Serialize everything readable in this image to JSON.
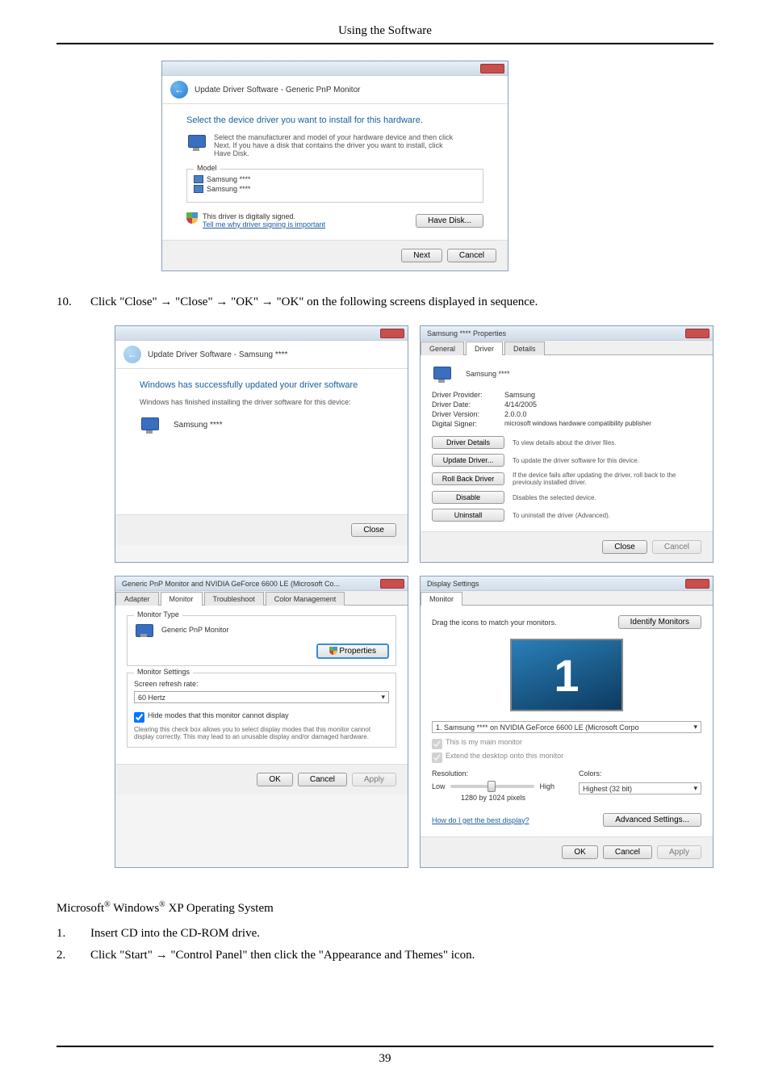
{
  "page_header": "Using the Software",
  "page_number": "39",
  "fig1": {
    "nav_title": "Update Driver Software - Generic PnP Monitor",
    "heading": "Select the device driver you want to install for this hardware.",
    "subtext": "Select the manufacturer and model of your hardware device and then click Next. If you have a disk that contains the driver you want to install, click Have Disk.",
    "model_legend": "Model",
    "model_items": [
      "Samsung ****",
      "Samsung ****"
    ],
    "signed_text": "This driver is digitally signed.",
    "signed_link": "Tell me why driver signing is important",
    "have_disk_btn": "Have Disk...",
    "next_btn": "Next",
    "cancel_btn": "Cancel"
  },
  "step10": {
    "num": "10.",
    "text": "Click \"Close\" → \"Close\" → \"OK\" → \"OK\" on the following screens displayed in sequence."
  },
  "quad_tl": {
    "nav_title": "Update Driver Software - Samsung ****",
    "heading": "Windows has successfully updated your driver software",
    "subtext": "Windows has finished installing the driver software for this device:",
    "device": "Samsung ****",
    "close_btn": "Close"
  },
  "quad_tr": {
    "title": "Samsung **** Properties",
    "tabs": [
      "General",
      "Driver",
      "Details"
    ],
    "device_name": "Samsung ****",
    "rows": {
      "provider_lbl": "Driver Provider:",
      "provider_val": "Samsung",
      "date_lbl": "Driver Date:",
      "date_val": "4/14/2005",
      "version_lbl": "Driver Version:",
      "version_val": "2.0.0.0",
      "signer_lbl": "Digital Signer:",
      "signer_val": "microsoft windows hardware compatibility publisher"
    },
    "btns": {
      "details": "Driver Details",
      "details_desc": "To view details about the driver files.",
      "update": "Update Driver...",
      "update_desc": "To update the driver software for this device.",
      "rollback": "Roll Back Driver",
      "rollback_desc": "If the device fails after updating the driver, roll back to the previously installed driver.",
      "disable": "Disable",
      "disable_desc": "Disables the selected device.",
      "uninstall": "Uninstall",
      "uninstall_desc": "To uninstall the driver (Advanced)."
    },
    "close_btn": "Close",
    "cancel_btn": "Cancel"
  },
  "quad_bl": {
    "title": "Generic PnP Monitor and NVIDIA GeForce 6600 LE (Microsoft Co...",
    "tabs": [
      "Adapter",
      "Monitor",
      "Troubleshoot",
      "Color Management"
    ],
    "monitor_type_legend": "Monitor Type",
    "monitor_name": "Generic PnP Monitor",
    "properties_btn": "Properties",
    "settings_legend": "Monitor Settings",
    "refresh_lbl": "Screen refresh rate:",
    "refresh_val": "60 Hertz",
    "hide_chk": "Hide modes that this monitor cannot display",
    "hide_desc": "Clearing this check box allows you to select display modes that this monitor cannot display correctly. This may lead to an unusable display and/or damaged hardware.",
    "ok_btn": "OK",
    "cancel_btn": "Cancel",
    "apply_btn": "Apply"
  },
  "quad_br": {
    "title": "Display Settings",
    "tab": "Monitor",
    "drag_text": "Drag the icons to match your monitors.",
    "identify_btn": "Identify Monitors",
    "monitor_num": "1",
    "monitor_select": "1. Samsung **** on NVIDIA GeForce 6600 LE (Microsoft Corpo",
    "main_chk": "This is my main monitor",
    "extend_chk": "Extend the desktop onto this monitor",
    "resolution_lbl": "Resolution:",
    "res_low": "Low",
    "res_high": "High",
    "res_val": "1280 by 1024 pixels",
    "colors_lbl": "Colors:",
    "colors_val": "Highest (32 bit)",
    "best_link": "How do I get the best display?",
    "adv_btn": "Advanced Settings...",
    "ok_btn": "OK",
    "cancel_btn": "Cancel",
    "apply_btn": "Apply"
  },
  "os_line": {
    "pre": "Microsoft",
    "mid": " Windows",
    "post": " XP Operating System"
  },
  "step1": {
    "num": "1.",
    "text": "Insert CD into the CD-ROM drive."
  },
  "step2": {
    "num": "2.",
    "text": "Click \"Start\" → \"Control Panel\" then click the \"Appearance and Themes\" icon."
  }
}
